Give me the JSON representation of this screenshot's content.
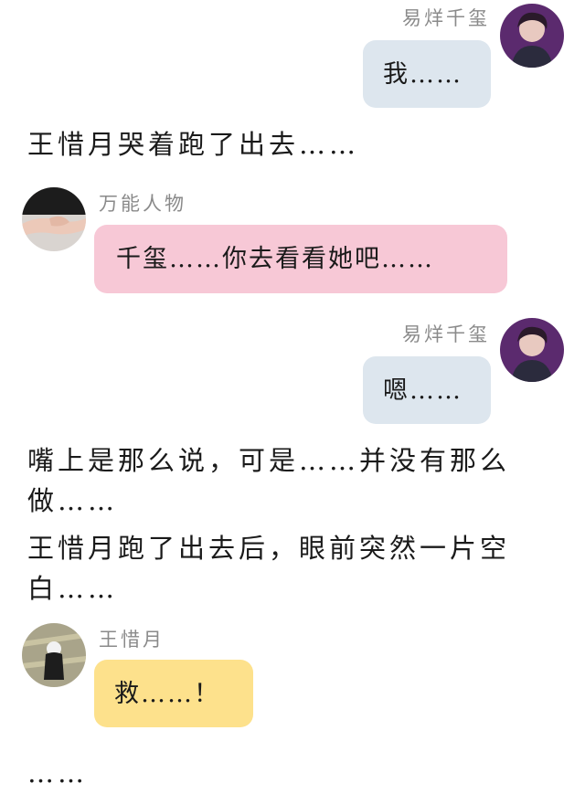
{
  "messages": [
    {
      "kind": "outgoing",
      "sender": "易烊千玺",
      "text": "我……"
    },
    {
      "kind": "narration",
      "text": "王惜月哭着跑了出去……"
    },
    {
      "kind": "incoming",
      "sender": "万能人物",
      "text": "千玺……你去看看她吧……"
    },
    {
      "kind": "outgoing",
      "sender": "易烊千玺",
      "text": "嗯……"
    },
    {
      "kind": "narration",
      "text": "嘴上是那么说，可是……并没有那么做……"
    },
    {
      "kind": "narration",
      "text": "王惜月跑了出去后，眼前突然一片空白……"
    },
    {
      "kind": "incoming",
      "sender": "王惜月",
      "text": "救……！"
    },
    {
      "kind": "narration",
      "text": "……"
    }
  ],
  "avatars": {
    "yiyang": "boy-portrait-avatar",
    "wanneng": "hands-avatar",
    "wangxiyue": "girl-back-avatar"
  },
  "colors": {
    "outgoing_bubble": "#dde6ee",
    "incoming_bubble_pink": "#f7c8d6",
    "incoming_bubble_yellow": "#fde18c",
    "sender_name": "#8a8a8a"
  }
}
